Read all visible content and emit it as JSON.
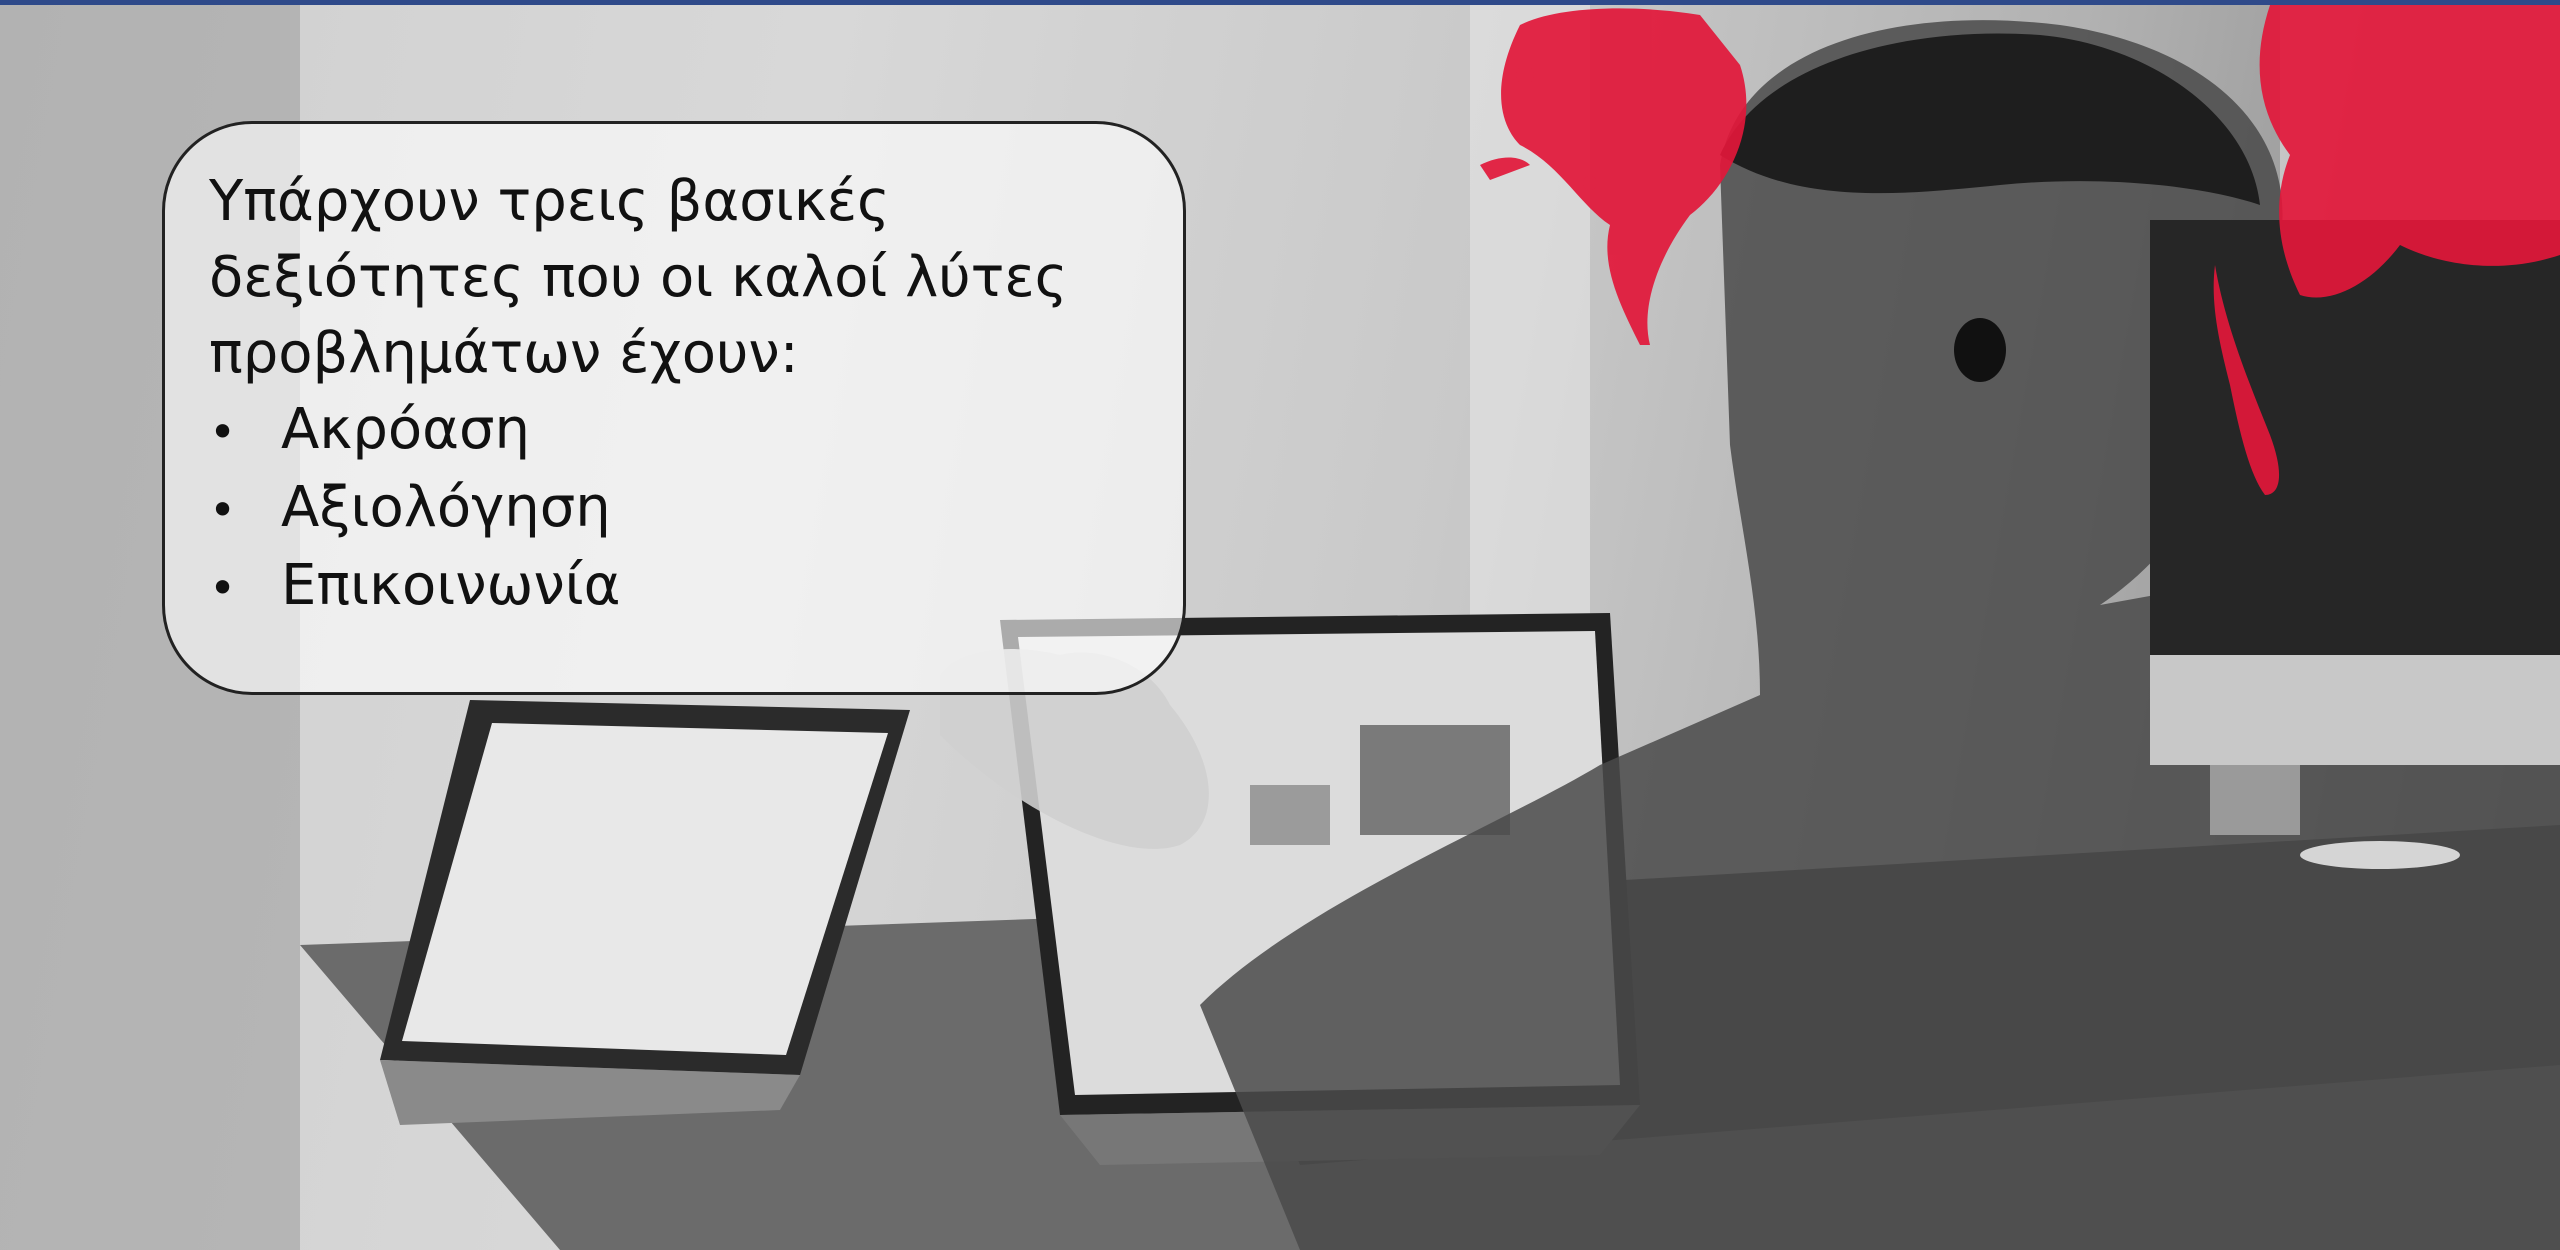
{
  "slide": {
    "accent_color": "#2f4a8a",
    "splash_color": "#e2173a",
    "callout": {
      "intro": "Υπάρχουν τρεις βασικές δεξιότητες που οι καλοί λύτες προβλημάτων έχουν:",
      "bullet_icon": "bullet-dot",
      "items": [
        {
          "label": "Ακρόαση"
        },
        {
          "label": "Αξιολόγηση"
        },
        {
          "label": "Επικοινωνία"
        }
      ]
    },
    "background_photo": {
      "subject_icons": [
        "laptop-icon",
        "laptop-icon",
        "monitor-icon",
        "person-silhouette",
        "paint-splash"
      ]
    }
  }
}
